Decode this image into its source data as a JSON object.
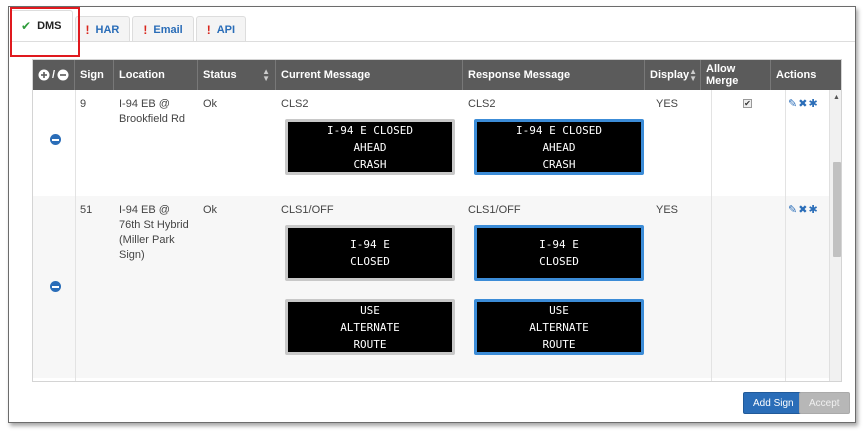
{
  "tabs": [
    {
      "label": "DMS",
      "status": "ok",
      "active": true
    },
    {
      "label": "HAR",
      "status": "error"
    },
    {
      "label": "Email",
      "status": "error"
    },
    {
      "label": "API",
      "status": "error"
    }
  ],
  "header": {
    "control_sep": "/",
    "sign": "Sign",
    "location": "Location",
    "status": "Status",
    "current": "Current Message",
    "response": "Response Message",
    "display": "Display",
    "allow_merge": "Allow Merge",
    "actions": "Actions"
  },
  "rows": [
    {
      "sign": "9",
      "location": "I-94 EB @ Brookfield Rd",
      "status": "Ok",
      "current_code": "CLS2",
      "response_code": "CLS2",
      "current_pages": [
        [
          "I-94 E CLOSED",
          "AHEAD",
          "CRASH"
        ]
      ],
      "response_pages": [
        [
          "I-94 E CLOSED",
          "AHEAD",
          "CRASH"
        ]
      ],
      "display": "YES",
      "allow_merge": true
    },
    {
      "sign": "51",
      "location": "I-94 EB @ 76th St Hybrid (Miller Park Sign)",
      "status": "Ok",
      "current_code": "CLS1/OFF",
      "response_code": "CLS1/OFF",
      "current_pages": [
        [
          "I-94 E",
          "CLOSED"
        ],
        [
          "USE",
          "ALTERNATE",
          "ROUTE"
        ]
      ],
      "response_pages": [
        [
          "I-94 E",
          "CLOSED"
        ],
        [
          "USE",
          "ALTERNATE",
          "ROUTE"
        ]
      ],
      "display": "YES",
      "allow_merge": false
    }
  ],
  "buttons": {
    "add_sign": "Add Sign",
    "accept": "Accept"
  },
  "colors": {
    "primary": "#2a6db8",
    "header_bg": "#5b5b5b",
    "ok_check": "#2e9c3b",
    "error_mark": "#d9261c",
    "highlight": "#e0191e",
    "response_border": "#3c8cd7"
  }
}
